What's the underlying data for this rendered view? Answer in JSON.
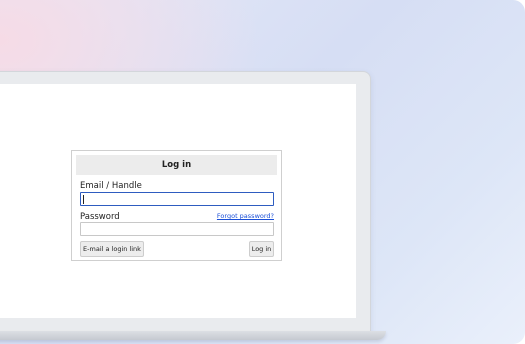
{
  "login": {
    "title": "Log in",
    "email_label": "Email / Handle",
    "email_value": "",
    "password_label": "Password",
    "forgot_link": "Forgot password?",
    "email_link_button": "E-mail a login link",
    "login_button": "Log in"
  }
}
